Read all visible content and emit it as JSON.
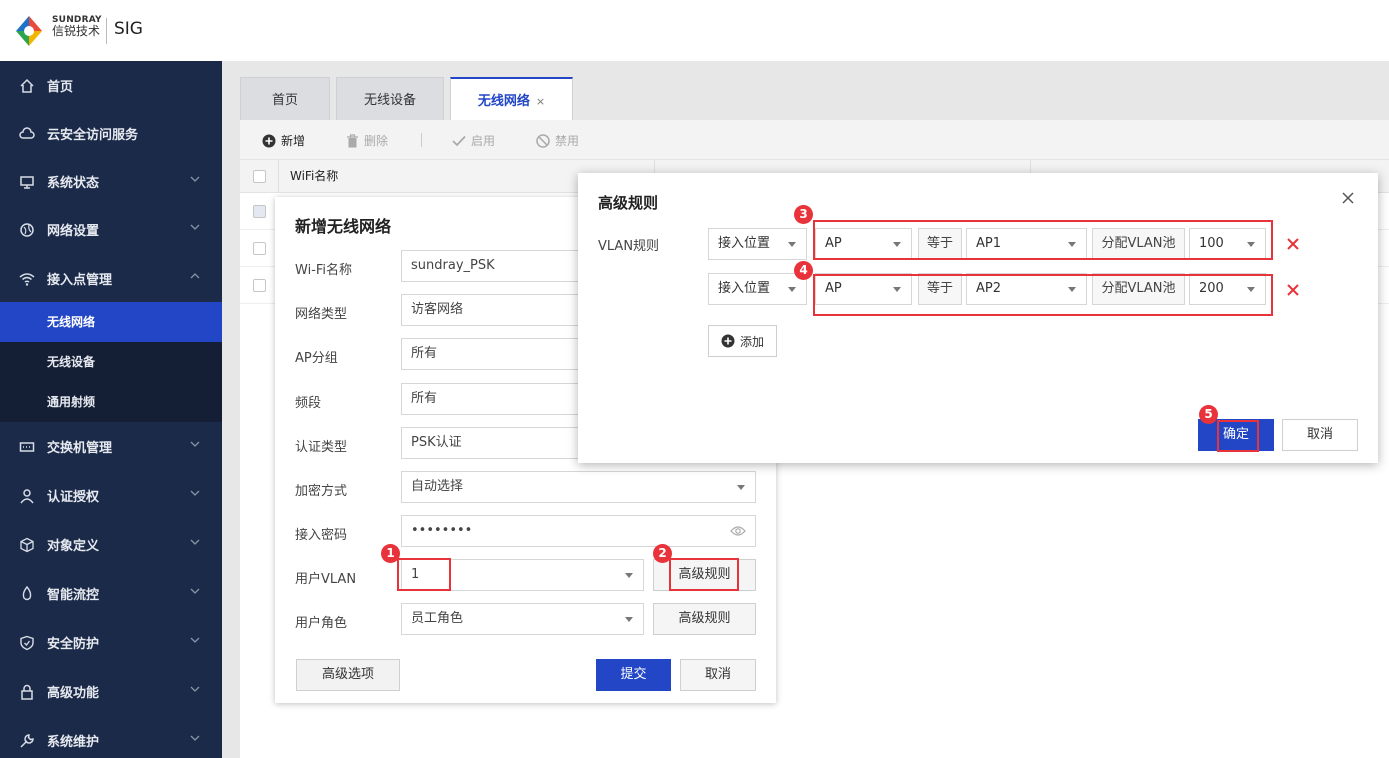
{
  "header": {
    "brand_en": "SUNDRAY",
    "brand_cn": "信锐技术",
    "product": "SIG"
  },
  "sidebar": {
    "items": [
      {
        "label": "首页",
        "icon": "home-icon"
      },
      {
        "label": "云安全访问服务",
        "icon": "cloud-icon"
      },
      {
        "label": "系统状态",
        "icon": "monitor-icon"
      },
      {
        "label": "网络设置",
        "icon": "globe-icon"
      },
      {
        "label": "接入点管理",
        "icon": "wifi-icon"
      },
      {
        "label": "交换机管理",
        "icon": "switch-icon"
      },
      {
        "label": "认证授权",
        "icon": "user-icon"
      },
      {
        "label": "对象定义",
        "icon": "cube-icon"
      },
      {
        "label": "智能流控",
        "icon": "flow-icon"
      },
      {
        "label": "安全防护",
        "icon": "shield-icon"
      },
      {
        "label": "高级功能",
        "icon": "lock-icon"
      },
      {
        "label": "系统维护",
        "icon": "wrench-icon"
      }
    ],
    "subitems": [
      {
        "label": "无线网络",
        "active": true
      },
      {
        "label": "无线设备",
        "active": false
      },
      {
        "label": "通用射频",
        "active": false
      }
    ]
  },
  "tabs": [
    {
      "label": "首页"
    },
    {
      "label": "无线设备"
    },
    {
      "label": "无线网络",
      "close": "×"
    }
  ],
  "toolbar": {
    "add": "新增",
    "delete": "删除",
    "enable": "启用",
    "disable": "禁用"
  },
  "table": {
    "columns": [
      "WiFi名称"
    ]
  },
  "form": {
    "title": "新增无线网络",
    "fields": [
      {
        "label": "Wi-Fi名称",
        "value": "sundray_PSK"
      },
      {
        "label": "网络类型",
        "value": "访客网络"
      },
      {
        "label": "AP分组",
        "value": "所有"
      },
      {
        "label": "频段",
        "value": "所有"
      },
      {
        "label": "认证类型",
        "value": "PSK认证"
      },
      {
        "label": "加密方式",
        "value": "自动选择"
      },
      {
        "label": "接入密码",
        "value": "••••••••"
      },
      {
        "label": "用户VLAN",
        "value": "1"
      },
      {
        "label": "用户角色",
        "value": "员工角色"
      }
    ],
    "advanced_rule": "高级规则",
    "advanced_options": "高级选项",
    "submit": "提交",
    "cancel": "取消"
  },
  "modal": {
    "title": "高级规则",
    "vlan_label": "VLAN规则",
    "rules": [
      {
        "field": "接入位置",
        "type": "AP",
        "op": "等于",
        "value": "AP1",
        "action": "分配VLAN池",
        "vlan": "100"
      },
      {
        "field": "接入位置",
        "type": "AP",
        "op": "等于",
        "value": "AP2",
        "action": "分配VLAN池",
        "vlan": "200"
      }
    ],
    "add": "添加",
    "confirm": "确定",
    "cancel": "取消"
  },
  "annotations": [
    "1",
    "2",
    "3",
    "4",
    "5"
  ],
  "colors": {
    "sidebar_bg": "#1b2a49",
    "accent": "#2246c5",
    "highlight": "#e8333b"
  }
}
